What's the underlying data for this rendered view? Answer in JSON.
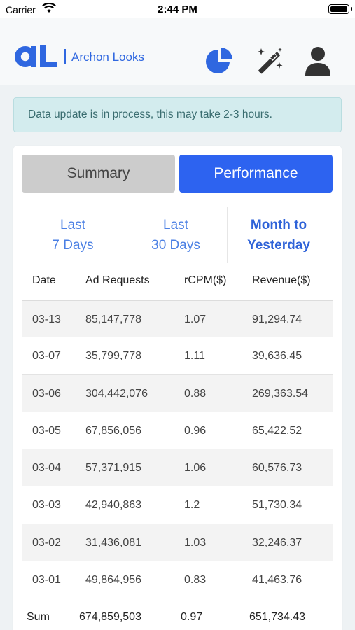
{
  "status_bar": {
    "carrier": "Carrier",
    "time": "2:44 PM"
  },
  "header": {
    "logo_text": "Archon Looks",
    "icons": [
      "pie-chart-icon",
      "magic-wand-icon",
      "user-icon"
    ],
    "brand_color": "#2f67e0"
  },
  "banner": {
    "message": "Data update is in process, this may take 2-3 hours."
  },
  "tabs": {
    "summary": "Summary",
    "performance": "Performance",
    "active": "Performance"
  },
  "ranges": [
    {
      "line1": "Last",
      "line2": "7 Days"
    },
    {
      "line1": "Last",
      "line2": "30 Days"
    },
    {
      "line1": "Month to",
      "line2": "Yesterday"
    }
  ],
  "active_range": "Month to Yesterday",
  "table": {
    "headers": {
      "date": "Date",
      "requests": "Ad Requests",
      "rcpm": "rCPM($)",
      "revenue": "Revenue($)"
    },
    "rows": [
      {
        "date": "03-13",
        "requests": "85,147,778",
        "rcpm": "1.07",
        "revenue": "91,294.74"
      },
      {
        "date": "03-07",
        "requests": "35,799,778",
        "rcpm": "1.11",
        "revenue": "39,636.45"
      },
      {
        "date": "03-06",
        "requests": "304,442,076",
        "rcpm": "0.88",
        "revenue": "269,363.54"
      },
      {
        "date": "03-05",
        "requests": "67,856,056",
        "rcpm": "0.96",
        "revenue": "65,422.52"
      },
      {
        "date": "03-04",
        "requests": "57,371,915",
        "rcpm": "1.06",
        "revenue": "60,576.73"
      },
      {
        "date": "03-03",
        "requests": "42,940,863",
        "rcpm": "1.2",
        "revenue": "51,730.34"
      },
      {
        "date": "03-02",
        "requests": "31,436,081",
        "rcpm": "1.03",
        "revenue": "32,246.37"
      },
      {
        "date": "03-01",
        "requests": "49,864,956",
        "rcpm": "0.83",
        "revenue": "41,463.76"
      }
    ],
    "sum": {
      "label": "Sum",
      "requests": "674,859,503",
      "rcpm": "0.97",
      "revenue": "651,734.43"
    }
  }
}
